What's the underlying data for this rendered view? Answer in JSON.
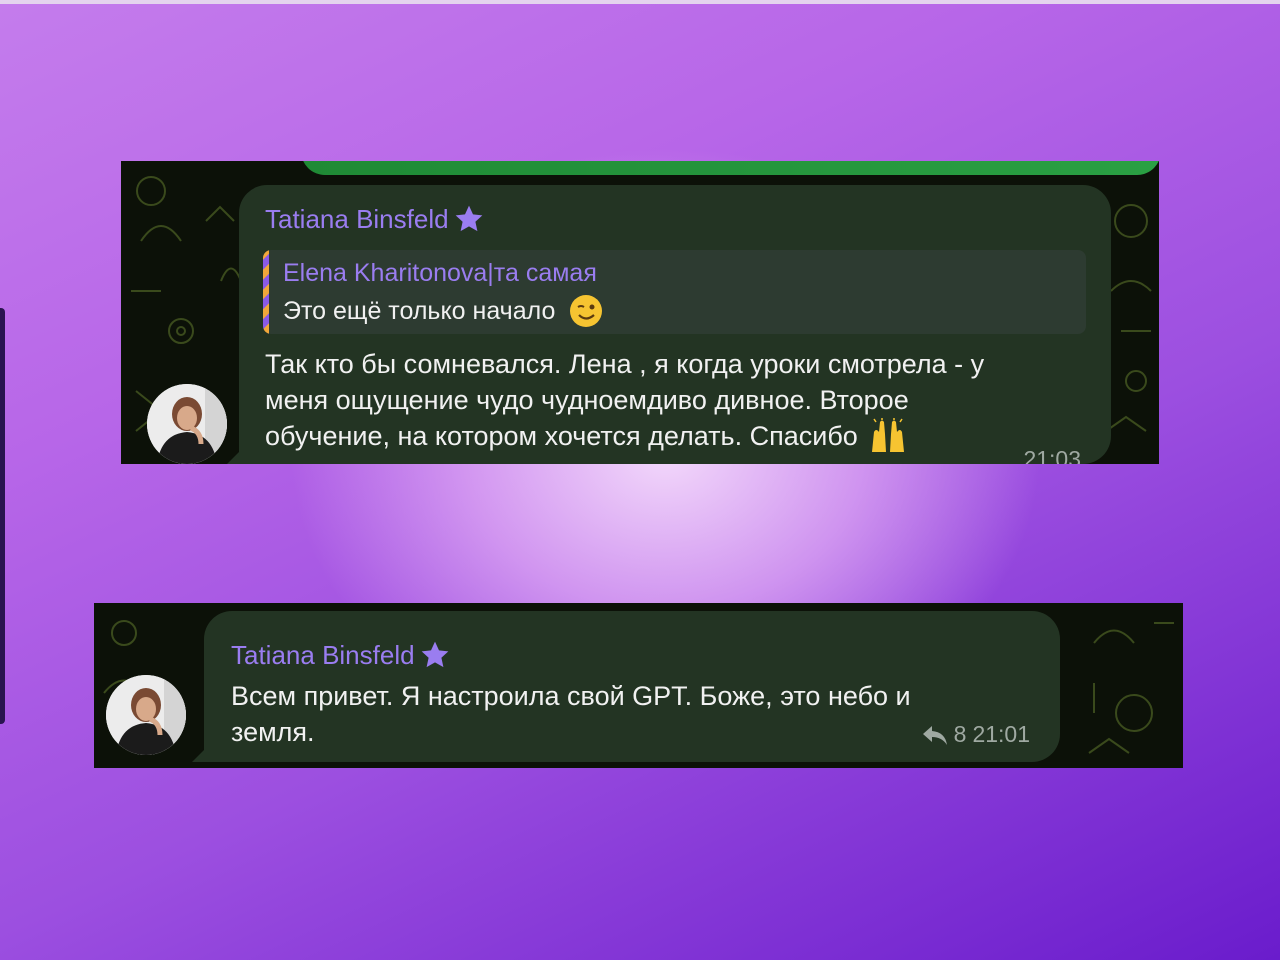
{
  "colors": {
    "background_accent": "#b766e8",
    "bubble": "#233423",
    "sender_name": "#9a7df0",
    "meta_text": "#9fa9a2",
    "chat_wallpaper": "#0c1108"
  },
  "message_1": {
    "sender": "Tatiana Binsfeld",
    "sender_badge_icon": "star-icon",
    "reply": {
      "author": "Elena Kharitonova|та самая",
      "text": "Это ещё только начало",
      "emoji_icon": "winking-face-icon"
    },
    "lines": [
      "Так кто бы сомневался. Лена , я когда уроки смотрела - у",
      "меня ощущение чудо чудноемдиво дивное. Второе",
      "обучение, на котором хочется делать. Спасибо"
    ],
    "end_emoji_icon": "raising-hands-icon",
    "time": "21:03"
  },
  "message_2": {
    "sender": "Tatiana Binsfeld",
    "sender_badge_icon": "star-icon",
    "lines": [
      "Всем привет. Я настроила свой GPT. Боже, это небо и",
      "земля."
    ],
    "reply_icon": "reply-arrow-icon",
    "reply_count": "8",
    "time": "21:01"
  }
}
